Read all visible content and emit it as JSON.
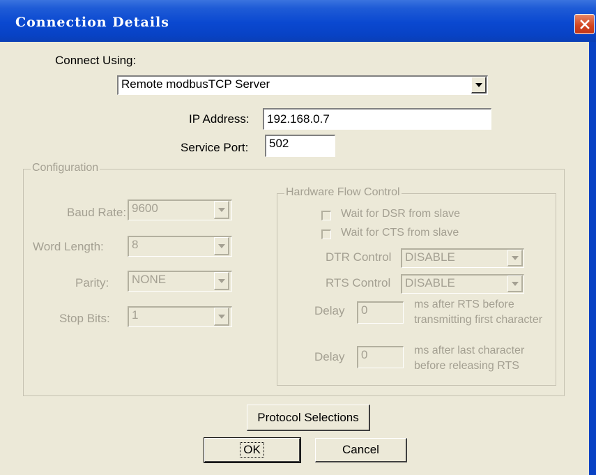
{
  "window": {
    "title": "Connection Details"
  },
  "connect": {
    "label": "Connect Using:",
    "value": "Remote modbusTCP Server"
  },
  "ip": {
    "label": "IP Address:",
    "value": "192.168.0.7"
  },
  "port": {
    "label": "Service Port:",
    "value": "502"
  },
  "configuration": {
    "title": "Configuration",
    "baud_rate": {
      "label": "Baud Rate:",
      "value": "9600"
    },
    "word_length": {
      "label": "Word Length:",
      "value": "8"
    },
    "parity": {
      "label": "Parity:",
      "value": "NONE"
    },
    "stop_bits": {
      "label": "Stop Bits:",
      "value": "1"
    }
  },
  "hardware_flow": {
    "title": "Hardware Flow Control",
    "dsr_label": "Wait for DSR from slave",
    "cts_label": "Wait for CTS from slave",
    "dtr": {
      "label": "DTR Control",
      "value": "DISABLE"
    },
    "rts": {
      "label": "RTS Control",
      "value": "DISABLE"
    },
    "delay1": {
      "label": "Delay",
      "value": "0",
      "desc1": "ms after RTS before",
      "desc2": "transmitting first character"
    },
    "delay2": {
      "label": "Delay",
      "value": "0",
      "desc1": "ms after last character",
      "desc2": "before releasing RTS"
    }
  },
  "buttons": {
    "protocol": "Protocol Selections",
    "ok": "OK",
    "cancel": "Cancel"
  },
  "colors": {
    "titlebar": "#0a48d0",
    "dialog_bg": "#ece9d8",
    "disabled_text": "#a4a092",
    "close_button": "#d2441f"
  }
}
